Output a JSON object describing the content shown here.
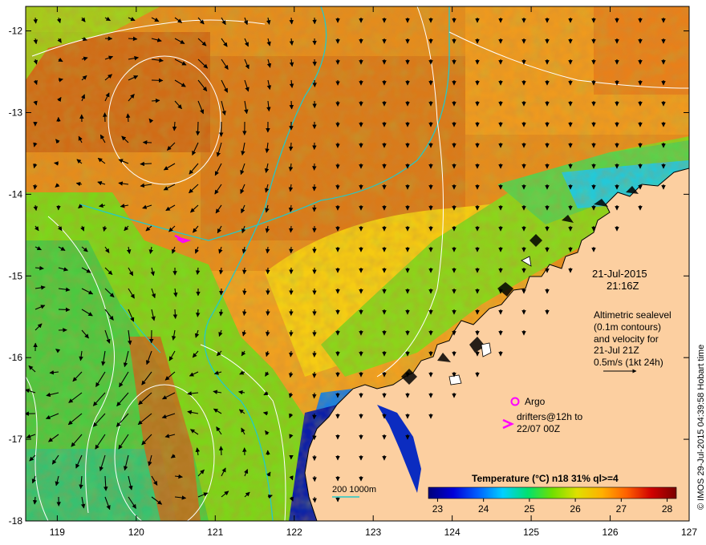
{
  "map": {
    "lon_ticks": [
      "119",
      "120",
      "121",
      "122",
      "123",
      "124",
      "125",
      "126",
      "127"
    ],
    "lat_ticks": [
      "-12",
      "-13",
      "-14",
      "-15",
      "-16",
      "-17",
      "-18"
    ],
    "lon_range": [
      118.6,
      127.0
    ],
    "lat_range": [
      -18.0,
      -11.7
    ]
  },
  "annotations": {
    "date": "21-Jul-2015",
    "time": "21:16Z",
    "altimetry_lines": [
      "Altimetric sealevel",
      "(0.1m contours)",
      "and velocity for",
      "21-Jul 21Z"
    ],
    "velocity_scale": "0.5m/s (1kt 24h)",
    "argo_label": "Argo",
    "drifters_line1": "drifters@12h to",
    "drifters_line2": "22/07 00Z",
    "isobath_label": "200  1000m",
    "credit": "© IMOS 29-Jul-2015 04:39:58 Hobart time"
  },
  "colorbar": {
    "title": "Temperature (°C) n18 31% ql>=4",
    "ticks": [
      "23",
      "24",
      "25",
      "26",
      "27",
      "28"
    ],
    "range": [
      22.8,
      28.2
    ],
    "colors": [
      "#00007a",
      "#0000d8",
      "#0060ff",
      "#00d0ff",
      "#00e070",
      "#70e000",
      "#e0e000",
      "#ffb000",
      "#ff6000",
      "#d00000",
      "#7a0000"
    ]
  },
  "colors": {
    "land": "#fccfa0",
    "coast_edge": "#000000",
    "isobath": "#25c8c8",
    "contour": "#ffffff",
    "argo": "#ff00ff",
    "drifter": "#ff00ff"
  }
}
